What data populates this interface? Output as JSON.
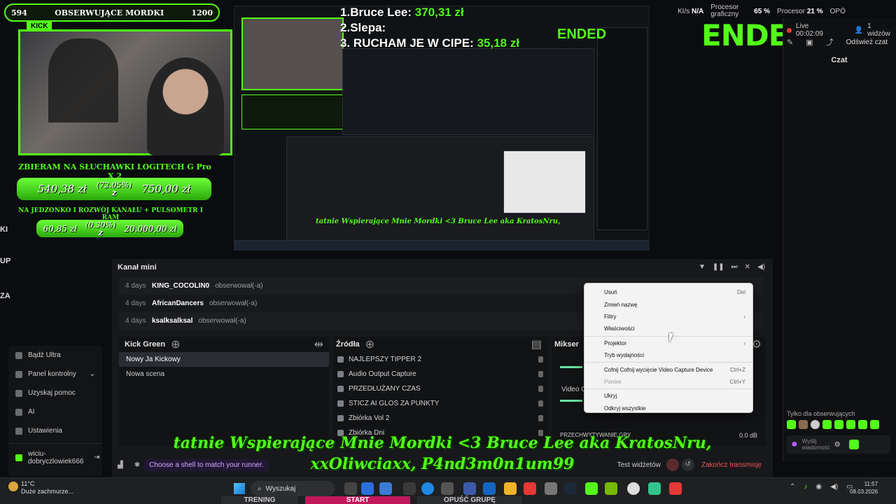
{
  "overlay": {
    "stream_bar": {
      "left_count": "594",
      "title": "OBSERWUJĄCE MORDKI",
      "right_count": "1200"
    },
    "kick_badge": "KICK",
    "goal1": {
      "title": "ZBIERAM NA SŁUCHAWKI LOGITECH G Pro X 2",
      "current": "540,38 zł",
      "percent": "(72.05%)",
      "symbol": "z",
      "target": "750,00 zł"
    },
    "goal2": {
      "title": "NA JEDZONKO I ROZWÓJ KANAŁU + PULSOMETR I RAM",
      "current": "60,85 zł",
      "percent": "(0.30%)",
      "symbol": "z",
      "target": "20.000,00 zł"
    },
    "left_edge": [
      "KI",
      "UP",
      "ZA"
    ],
    "top_donors": [
      {
        "rank": "1.",
        "name": "Bruce Lee:",
        "amount": "370,31 zł"
      },
      {
        "rank": "2.",
        "name": "Slepa:",
        "amount": ""
      },
      {
        "rank": "3.",
        "name": "RUCHAM JE W CIPE:",
        "amount": "35,18 zł"
      }
    ],
    "ended": "ENDED",
    "ticker_line1": "tatnie Wspierające Mnie Mordki <3 Bruce Lee aka KratosNru,",
    "ticker_line2": "xxOliwciaxx, P4nd3m0n1um99"
  },
  "system": {
    "kbs_label": "KI/s",
    "kbs_value": "N/A",
    "cpu_label": "Procesor graficzny",
    "gpu_pct": "65 %",
    "proc_label": "Procesor",
    "proc_pct": "21 %",
    "extra": "OPÓ"
  },
  "right_panel": {
    "live_label": "Live 00:02:09",
    "viewers": "1 widzów",
    "refresh": "Odśwież czat",
    "chat_title": "Czat",
    "followers_only": "Tylko dla obserwujących",
    "send_placeholder": "Wyślij wiadomość"
  },
  "activity": {
    "title": "Kanał mini",
    "rows": [
      {
        "ago": "4 days",
        "user": "KING_COCOLIN0",
        "action": "obserwował(-a)"
      },
      {
        "ago": "4 days",
        "user": "AfricanDancers",
        "action": "obserwował(-a)"
      },
      {
        "ago": "4 days",
        "user": "ksalksalksal",
        "action": "obserwował(-a)"
      }
    ]
  },
  "sidebar": {
    "items": [
      {
        "icon": "ultra-icon",
        "label": "Bądź Ultra"
      },
      {
        "icon": "dashboard-icon",
        "label": "Panel kontrolny"
      },
      {
        "icon": "help-icon",
        "label": "Uzyskaj pomoc"
      },
      {
        "icon": "ai-icon",
        "label": "AI"
      },
      {
        "icon": "settings-icon",
        "label": "Ustawienia"
      }
    ],
    "user": "wiciu-dobryczlowiek666"
  },
  "scenes": {
    "title": "Kick Green",
    "items": [
      "Nowy Ja Kickowy",
      "Nowa scena"
    ]
  },
  "sources": {
    "title": "Źródła",
    "items": [
      "NAJLEPSZY TIPPER 2",
      "Audio Output Capture",
      "PRZEDŁUŻANY CZAS",
      "STICZ AI GLOS ZA PUNKTY",
      "Zbiórka Vol 2",
      "Zbiórka Dni"
    ]
  },
  "mixer": {
    "title": "Mikser",
    "channel_label": "Video C",
    "bottom_label": "PRZECHWYTYWANIE GRY",
    "db": "0.0 dB"
  },
  "context_menu": {
    "items": [
      {
        "label": "Usuń",
        "shortcut": "Del",
        "disabled": false
      },
      {
        "label": "Zmień nazwę",
        "shortcut": "",
        "disabled": false
      },
      {
        "label": "Filtry",
        "shortcut": "›",
        "disabled": false
      },
      {
        "label": "Właściwości",
        "shortcut": "",
        "disabled": false
      },
      {
        "label": "Projektor",
        "shortcut": "›",
        "disabled": false
      },
      {
        "label": "Tryb wydajności",
        "shortcut": "",
        "disabled": false
      },
      {
        "label": "Cofnij Cofnij wycięcie Video Capture Device",
        "shortcut": "Ctrl+Z",
        "disabled": false
      },
      {
        "label": "Ponów",
        "shortcut": "Ctrl+Y",
        "disabled": true
      },
      {
        "label": "Ukryj",
        "shortcut": "",
        "disabled": false
      },
      {
        "label": "Odkryj wszystkie",
        "shortcut": "",
        "disabled": false
      }
    ]
  },
  "bottom_bar": {
    "runner_hint": "Choose a shell to match your runner.",
    "test_widgets": "Test widżetów",
    "end_stream": "Zakończ transmisję"
  },
  "taskbar": {
    "temp": "11°C",
    "weather": "Duże zachmurze...",
    "search": "Wyszukaj",
    "time": "11:57",
    "date": "08.03.2026"
  },
  "strip": [
    "TRENING",
    "START",
    "OPUŚĆ GRUPĘ"
  ],
  "colors": {
    "accent": "#53fc18",
    "panel": "#17181b",
    "danger": "#e53935"
  }
}
